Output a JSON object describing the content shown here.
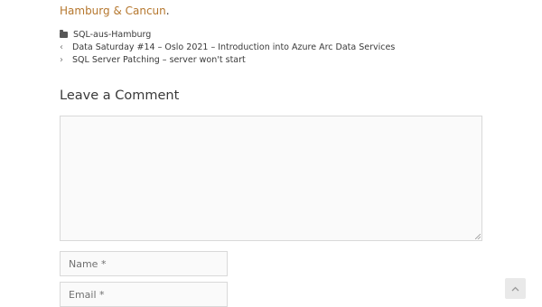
{
  "prev_text": {
    "link": "Hamburg & Cancun",
    "tail": "."
  },
  "meta": {
    "category_icon": "folder-icon",
    "category": "SQL-aus-Hamburg"
  },
  "post_nav": {
    "previous_label": "Data Saturday #14 – Oslo 2021 – Introduction into Azure Arc Data Services",
    "next_label": "SQL Server Patching – server won't start"
  },
  "comments": {
    "heading": "Leave a Comment",
    "name_placeholder": "Name *",
    "email_placeholder": "Email *"
  }
}
